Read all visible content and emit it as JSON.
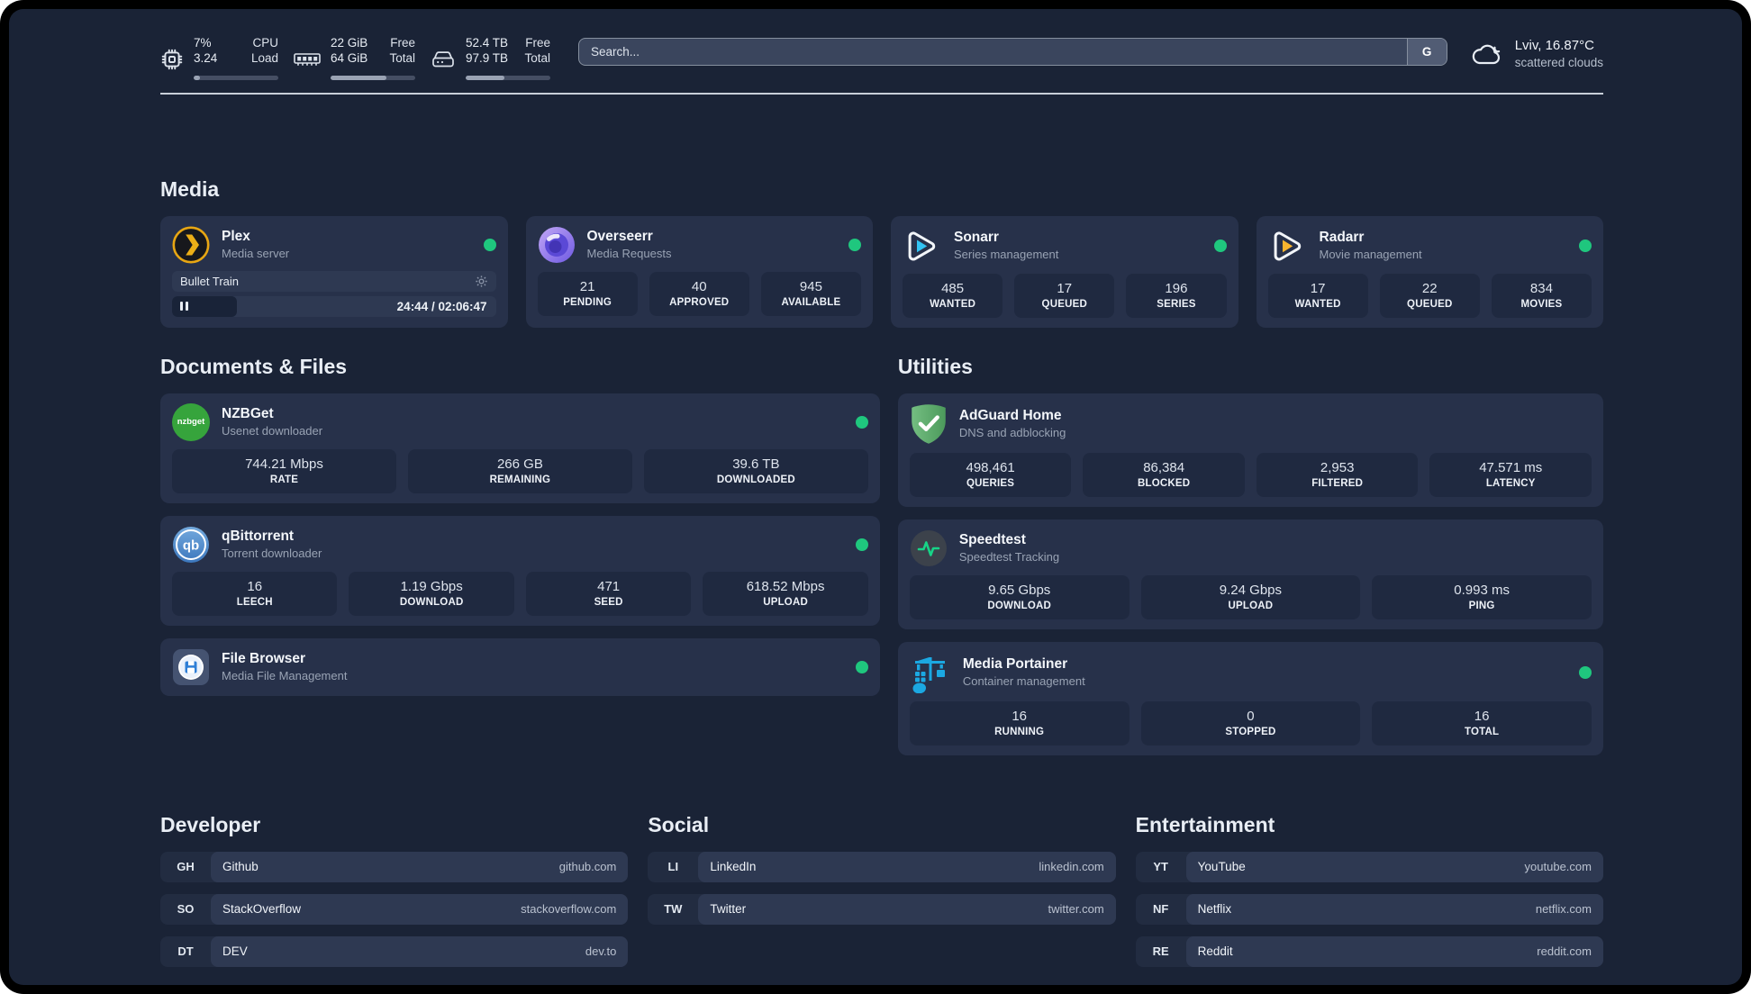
{
  "colors": {
    "background": "#1a2336",
    "card": "#27314a",
    "tile": "#1f2940",
    "row": "#2e3952",
    "status-green": "#1fc77e",
    "separator": "#c9cfd9",
    "bar-track": "#454e63",
    "bar-fill": "#9aa3b4"
  },
  "header": {
    "resources": [
      {
        "id": "cpu",
        "icon": "cpu-icon",
        "value_top": "7%",
        "value_bottom": "3.24",
        "label_top": "CPU",
        "label_bottom": "Load",
        "percent": 7
      },
      {
        "id": "memory",
        "icon": "ram-icon",
        "value_top": "22 GiB",
        "value_bottom": "64 GiB",
        "label_top": "Free",
        "label_bottom": "Total",
        "percent": 66
      },
      {
        "id": "disk",
        "icon": "disk-icon",
        "value_top": "52.4 TB",
        "value_bottom": "97.9 TB",
        "label_top": "Free",
        "label_bottom": "Total",
        "percent": 46
      }
    ],
    "search": {
      "placeholder": "Search...",
      "button": "G"
    },
    "weather": {
      "icon": "cloud-icon",
      "location": "Lviv, 16.87°C",
      "condition": "scattered clouds"
    }
  },
  "sections": {
    "media": {
      "title": "Media",
      "cards": [
        {
          "id": "plex",
          "icon": "plex-icon",
          "name": "Plex",
          "subtitle": "Media server",
          "status_dot": true,
          "player": {
            "title": "Bullet Train",
            "time": "24:44 / 02:06:47",
            "progress_percent": 20
          }
        },
        {
          "id": "overseerr",
          "icon": "overseerr-icon",
          "name": "Overseerr",
          "subtitle": "Media Requests",
          "status_dot": true,
          "stats": [
            {
              "value": "21",
              "label": "PENDING"
            },
            {
              "value": "40",
              "label": "APPROVED"
            },
            {
              "value": "945",
              "label": "AVAILABLE"
            }
          ]
        },
        {
          "id": "sonarr",
          "icon": "sonarr-icon",
          "name": "Sonarr",
          "subtitle": "Series management",
          "status_dot": true,
          "stats": [
            {
              "value": "485",
              "label": "WANTED"
            },
            {
              "value": "17",
              "label": "QUEUED"
            },
            {
              "value": "196",
              "label": "SERIES"
            }
          ]
        },
        {
          "id": "radarr",
          "icon": "radarr-icon",
          "name": "Radarr",
          "subtitle": "Movie management",
          "status_dot": true,
          "stats": [
            {
              "value": "17",
              "label": "WANTED"
            },
            {
              "value": "22",
              "label": "QUEUED"
            },
            {
              "value": "834",
              "label": "MOVIES"
            }
          ]
        }
      ]
    },
    "documents": {
      "title": "Documents & Files",
      "cards": [
        {
          "id": "nzbget",
          "icon": "nzbget-icon",
          "name": "NZBGet",
          "subtitle": "Usenet downloader",
          "status_dot": true,
          "stats": [
            {
              "value": "744.21 Mbps",
              "label": "RATE"
            },
            {
              "value": "266 GB",
              "label": "REMAINING"
            },
            {
              "value": "39.6 TB",
              "label": "DOWNLOADED"
            }
          ]
        },
        {
          "id": "qbittorrent",
          "icon": "qbittorrent-icon",
          "name": "qBittorrent",
          "subtitle": "Torrent downloader",
          "status_dot": true,
          "stats": [
            {
              "value": "16",
              "label": "LEECH"
            },
            {
              "value": "1.19 Gbps",
              "label": "DOWNLOAD"
            },
            {
              "value": "471",
              "label": "SEED"
            },
            {
              "value": "618.52 Mbps",
              "label": "UPLOAD"
            }
          ]
        },
        {
          "id": "filebrowser",
          "icon": "filebrowser-icon",
          "name": "File Browser",
          "subtitle": "Media File Management",
          "status_dot": true
        }
      ]
    },
    "utilities": {
      "title": "Utilities",
      "cards": [
        {
          "id": "adguard",
          "icon": "adguard-icon",
          "name": "AdGuard Home",
          "subtitle": "DNS and adblocking",
          "status_dot": false,
          "stats": [
            {
              "value": "498,461",
              "label": "QUERIES"
            },
            {
              "value": "86,384",
              "label": "BLOCKED"
            },
            {
              "value": "2,953",
              "label": "FILTERED"
            },
            {
              "value": "47.571 ms",
              "label": "LATENCY"
            }
          ]
        },
        {
          "id": "speedtest",
          "icon": "speedtest-icon",
          "name": "Speedtest",
          "subtitle": "Speedtest Tracking",
          "status_dot": false,
          "stats": [
            {
              "value": "9.65 Gbps",
              "label": "DOWNLOAD"
            },
            {
              "value": "9.24 Gbps",
              "label": "UPLOAD"
            },
            {
              "value": "0.993 ms",
              "label": "PING"
            }
          ]
        },
        {
          "id": "portainer",
          "icon": "portainer-icon",
          "name": "Media Portainer",
          "subtitle": "Container management",
          "status_dot": true,
          "stats": [
            {
              "value": "16",
              "label": "RUNNING"
            },
            {
              "value": "0",
              "label": "STOPPED"
            },
            {
              "value": "16",
              "label": "TOTAL"
            }
          ]
        }
      ]
    }
  },
  "bookmarks": [
    {
      "title": "Developer",
      "links": [
        {
          "abbr": "GH",
          "name": "Github",
          "url": "github.com"
        },
        {
          "abbr": "SO",
          "name": "StackOverflow",
          "url": "stackoverflow.com"
        },
        {
          "abbr": "DT",
          "name": "DEV",
          "url": "dev.to"
        }
      ]
    },
    {
      "title": "Social",
      "links": [
        {
          "abbr": "LI",
          "name": "LinkedIn",
          "url": "linkedin.com"
        },
        {
          "abbr": "TW",
          "name": "Twitter",
          "url": "twitter.com"
        }
      ]
    },
    {
      "title": "Entertainment",
      "links": [
        {
          "abbr": "YT",
          "name": "YouTube",
          "url": "youtube.com"
        },
        {
          "abbr": "NF",
          "name": "Netflix",
          "url": "netflix.com"
        },
        {
          "abbr": "RE",
          "name": "Reddit",
          "url": "reddit.com"
        }
      ]
    }
  ]
}
